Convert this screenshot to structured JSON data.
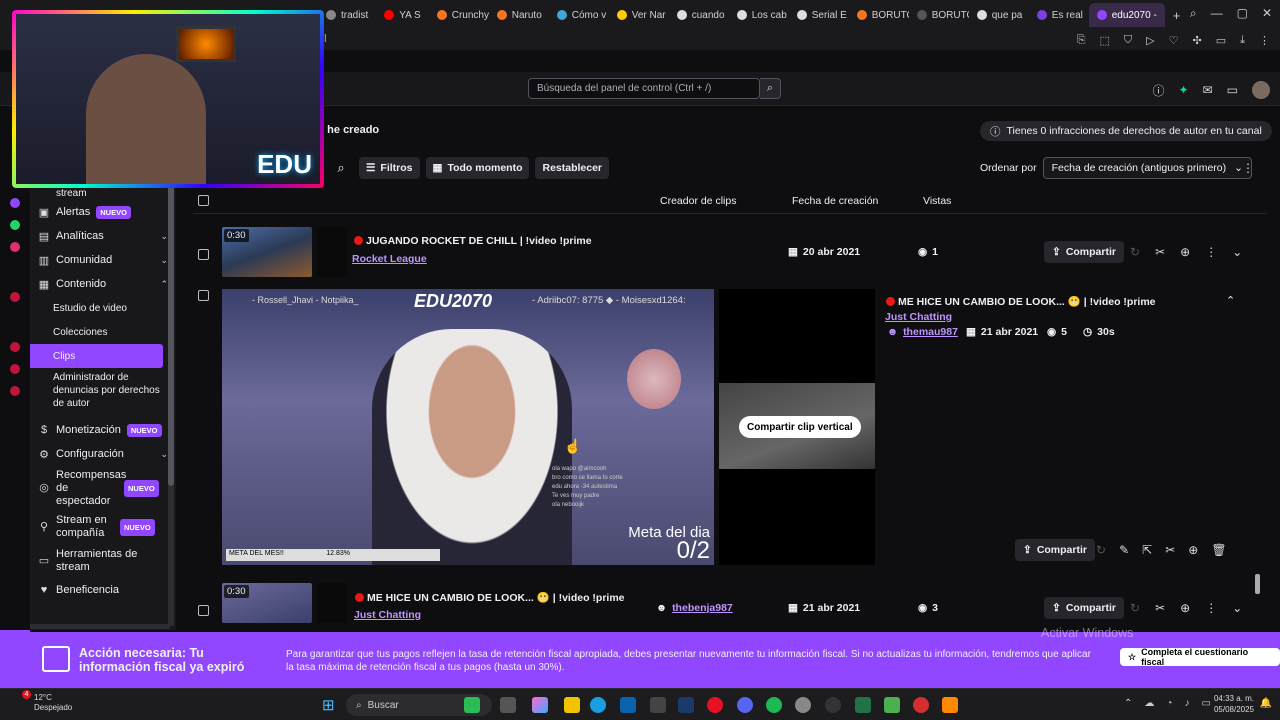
{
  "browser": {
    "tabs": [
      {
        "label": "tradist",
        "color": "#888888"
      },
      {
        "label": "YA S",
        "color": "#ff0000"
      },
      {
        "label": "Crunchy",
        "color": "#f47521"
      },
      {
        "label": "Naruto",
        "color": "#f47521"
      },
      {
        "label": "Cómo v",
        "color": "#3fa7d6"
      },
      {
        "label": "Ver Nar",
        "color": "#ffcc00"
      },
      {
        "label": "cuando",
        "color": "#dddddd"
      },
      {
        "label": "Los cab",
        "color": "#dddddd"
      },
      {
        "label": "Serial E",
        "color": "#dddddd"
      },
      {
        "label": "BORUTO",
        "color": "#f47521"
      },
      {
        "label": "BORUTO",
        "color": "#555555"
      },
      {
        "label": "que pa",
        "color": "#dddddd"
      },
      {
        "label": "Es real",
        "color": "#7b3fe4"
      }
    ],
    "active_tab": "edu2070 - ",
    "address_suffix": "el"
  },
  "header": {
    "search_placeholder": "Búsqueda del panel de control (Ctrl + /)"
  },
  "webcam": {
    "overlay_text": "EDU"
  },
  "sidebar": {
    "items": [
      {
        "label": "stream",
        "type": "partial"
      },
      {
        "label": "Alertas",
        "badge": "NUEVO",
        "icon": "bell-icon"
      },
      {
        "label": "Analíticas",
        "icon": "chart-icon",
        "chevron": "down"
      },
      {
        "label": "Comunidad",
        "icon": "users-icon",
        "chevron": "down"
      },
      {
        "label": "Contenido",
        "icon": "folder-icon",
        "chevron": "up"
      },
      {
        "label": "Estudio de video",
        "sub": true
      },
      {
        "label": "Colecciones",
        "sub": true
      },
      {
        "label": "Clips",
        "sub": true,
        "active": true
      },
      {
        "label": "Administrador de denuncias por derechos de autor",
        "sub": true
      },
      {
        "label": "Monetización",
        "badge": "NUEVO",
        "icon": "money-icon"
      },
      {
        "label": "Configuración",
        "icon": "gear-icon",
        "chevron": "down"
      },
      {
        "label": "Recompensas de espectador",
        "badge": "NUEVO",
        "icon": "reward-icon"
      },
      {
        "label": "Stream en compañía",
        "badge": "NUEVO",
        "icon": "companion-icon"
      },
      {
        "label": "Herramientas de stream",
        "icon": "camera-icon"
      },
      {
        "label": "Beneficencia",
        "icon": "charity-icon"
      }
    ]
  },
  "page": {
    "crumb": "e he creado",
    "copyright_notice": "Tienes 0 infracciones de derechos de autor en tu canal"
  },
  "toolbar": {
    "filters": "Filtros",
    "time": "Todo momento",
    "reset": "Restablecer",
    "sort_label": "Ordenar por",
    "sort_value": "Fecha de creación (antiguos primero)"
  },
  "table": {
    "headers": {
      "creator": "Creador de clips",
      "date": "Fecha de creación",
      "views": "Vistas"
    }
  },
  "clips": [
    {
      "duration": "0:30",
      "title": "JUGANDO ROCKET DE CHILL | !video !prime",
      "category": "Rocket League",
      "creator": "",
      "date": "20 abr 2021",
      "views": "1",
      "share": "Compartir"
    },
    {
      "duration": "0:30",
      "title": "ME HICE UN CAMBIO DE LOOK... 😬 | !video !prime",
      "category": "Just Chatting",
      "creator": "themau987",
      "date": "21 abr 2021",
      "views": "5",
      "length": "30s",
      "share": "Compartir",
      "vertical_button": "Compartir clip vertical"
    },
    {
      "duration": "0:30",
      "title": "ME HICE UN CAMBIO DE LOOK... 😬 | !video !prime",
      "category": "Just Chatting",
      "creator": "thebenja987",
      "date": "21 abr 2021",
      "views": "3",
      "share": "Compartir"
    }
  ],
  "video_overlay": {
    "brand": "EDU2070",
    "names_left": "- Rossell_Jhavi     - Notpiika_",
    "names_right": "- Adriibc07: 8775 ◆ - Moisesxd1264:",
    "goal_label": "Meta del dia",
    "goal_value": "0/2",
    "month_goal": "META DEL MES!!",
    "month_pct": "12.83%",
    "chat": [
      "ola wapo @aimcooh",
      "bro como se llama tu corte",
      "edu ahora -34 autestima",
      "Te ves muy padre",
      "ola nebooijk"
    ]
  },
  "banner": {
    "title": "Acción necesaria: Tu información fiscal ya expiró",
    "text": "Para garantizar que tus pagos reflejen la tasa de retención fiscal apropiada, debes presentar nuevamente tu información fiscal. Si no actualizas tu información, tendremos que aplicar la tasa máxima de retención fiscal a tus pagos (hasta un 30%).",
    "button": "Completa el cuestionario fiscal"
  },
  "windows": {
    "watermark": "Activar Windows",
    "temperature": "12°C",
    "weather": "Despejado",
    "search": "Buscar",
    "time": "04:33 a. m.",
    "date": "05/08/2025",
    "notif_count": "4"
  },
  "colors": {
    "accent": "#9147ff",
    "live": "#e91916",
    "link": "#bf94ff"
  }
}
